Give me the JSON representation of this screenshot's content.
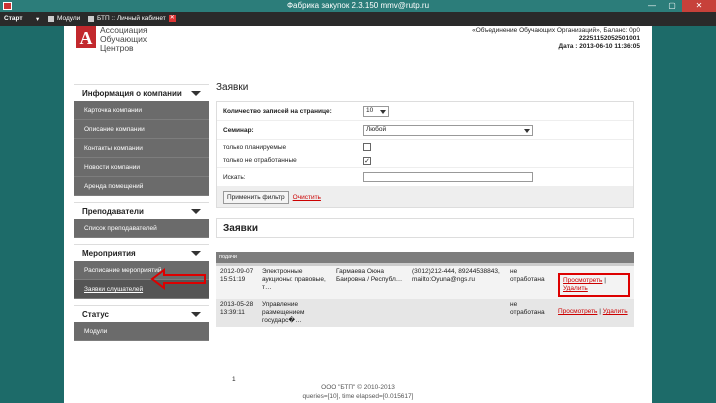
{
  "window": {
    "title": "Фабрика закупок 2.3.150 mmv@rutp.ru",
    "minimize": "—",
    "maximize": "▢",
    "close": "✕"
  },
  "taskbar": {
    "start": "Старт",
    "tabs": [
      "Модули",
      "БТП :: Личный кабинет"
    ],
    "tab_close": "✕"
  },
  "header": {
    "logo_letter": "А",
    "logo_lines": [
      "Ассоциация",
      "Обучающих",
      "Центров"
    ],
    "org_line": "«Объединение Обучающих Организаций», Баланс: 0р0",
    "id_line": "22251152052501001",
    "date_line": "Дата : 2013-06-10 11:36:05"
  },
  "sidebar": {
    "sections": [
      {
        "title": "Информация о компании",
        "items": [
          "Карточка компании",
          "Описание компании",
          "Контакты компании",
          "Новости компании",
          "Аренда помещений"
        ]
      },
      {
        "title": "Преподаватели",
        "items": [
          "Список преподавателей"
        ]
      },
      {
        "title": "Мероприятия",
        "items": [
          "Расписание мероприятий",
          "Заявки слушателей"
        ]
      },
      {
        "title": "Статус",
        "items": [
          "Модули"
        ]
      }
    ]
  },
  "main": {
    "page_title": "Заявки",
    "filter": {
      "per_page_label": "Количество записей на странице:",
      "per_page_value": "10",
      "seminar_label": "Семинар:",
      "seminar_value": "Любой",
      "planned_label": "только планируемые",
      "planned_checked": false,
      "unprocessed_label": "только не отработанные",
      "unprocessed_checked": true,
      "unprocessed_mark": "✓",
      "search_label": "Искать:",
      "search_value": "",
      "apply_label": "Применить фильтр",
      "clear_label": "Очистить"
    },
    "section_title": "Заявки",
    "table_header": "подачи",
    "rows": [
      {
        "date": "2012-09-07 15:51:19",
        "seminar": "Электронные аукционы: правовые, т…",
        "name": "Гармаева Оюна Баировна / Республ…",
        "contact": "(3012)212-444, 89244538843, mailto:Oyuna@ngs.ru",
        "status": "не отработана",
        "view": "Просмотреть",
        "sep": "|",
        "delete": "Удалить"
      },
      {
        "date": "2013-05-28 13:39:11",
        "seminar": "Управление размещением государс�…",
        "name": "",
        "contact": "",
        "status": "не отработана",
        "view": "Просмотреть",
        "sep": "|",
        "delete": "Удалить"
      }
    ],
    "pager": "1"
  },
  "footer": {
    "copyright": "ООО \"БТП\" © 2010-2013",
    "stats": "queries=[10], time elapsed=[0.015617]"
  },
  "colors": {
    "brand_red": "#c2282d",
    "highlight_red": "#dd0000",
    "sidebar_gray": "#6b6b6b",
    "window_teal": "#2c7d7a"
  }
}
